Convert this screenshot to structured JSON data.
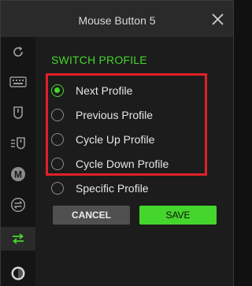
{
  "window": {
    "title": "Mouse Button 5"
  },
  "sidebar": {
    "items": [
      {
        "icon": "refresh-icon",
        "active": false
      },
      {
        "icon": "keyboard-icon",
        "active": false
      },
      {
        "icon": "mouse-icon",
        "active": false
      },
      {
        "icon": "mouse-function-icon",
        "active": false
      },
      {
        "icon": "macro-icon",
        "label": "M",
        "active": false
      },
      {
        "icon": "switch-icon",
        "active": false
      },
      {
        "icon": "switch-profile-icon",
        "active": true
      },
      {
        "icon": "lighting-icon",
        "active": false
      }
    ]
  },
  "content": {
    "section_title": "SWITCH PROFILE",
    "options": [
      {
        "label": "Next Profile",
        "checked": true
      },
      {
        "label": "Previous Profile",
        "checked": false
      },
      {
        "label": "Cycle Up Profile",
        "checked": false
      },
      {
        "label": "Cycle Down Profile",
        "checked": false
      },
      {
        "label": "Specific Profile",
        "checked": false
      }
    ],
    "cancel_label": "CANCEL",
    "save_label": "SAVE"
  },
  "colors": {
    "accent": "#44d62c",
    "highlight_border": "#e0202a",
    "background": "#1c1c1c",
    "titlebar": "#2a2a2a",
    "sidebar": "#151515",
    "cancel_button": "#505050"
  }
}
